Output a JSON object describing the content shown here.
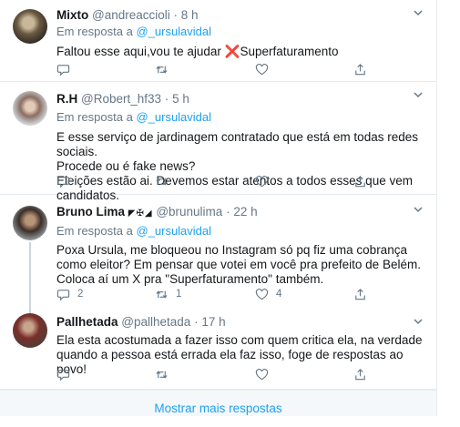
{
  "tweets": [
    {
      "name": "Mixto",
      "handle": "@andreaccioli",
      "time": "8 h",
      "reply_prefix": "Em resposta a",
      "reply_to": "@_ursulavidal",
      "text_before": "Faltou esse aqui,vou te ajudar ",
      "mark": "❌",
      "text_after": "Superfaturamento",
      "replies": "",
      "retweets": "",
      "likes": ""
    },
    {
      "name": "R.H",
      "handle": "@Robert_hf33",
      "time": "5 h",
      "reply_prefix": "Em resposta a",
      "reply_to": "@_ursulavidal",
      "text": "E esse serviço de jardinagem contratado que está em todas redes sociais.\nProcede ou é fake news?\n Eleições estão ai. Devemos estar atentos a todos esses que vem candidatos.",
      "replies": "",
      "retweets": "",
      "likes": ""
    },
    {
      "name": "Bruno Lima",
      "badges": "◤✠◢",
      "handle": "@brunulima",
      "time": "22 h",
      "reply_prefix": "Em resposta a",
      "reply_to": "@_ursulavidal",
      "text": "Poxa Ursula, me bloqueou no Instagram só pq fiz uma cobrança como eleitor? Em pensar que votei em você pra prefeito de Belém. Coloca aí um X pra \"Superfaturamento\" também.",
      "replies": "2",
      "retweets": "1",
      "likes": "4"
    },
    {
      "name": "Pallhetada",
      "handle": "@pallhetada",
      "time": "17 h",
      "text": "Ela esta acostumada a fazer isso com quem critica ela, na verdade quando a pessoa está errada ela faz isso, foge de respostas ao povo!",
      "replies": "",
      "retweets": "",
      "likes": ""
    }
  ],
  "show_more_label": "Mostrar mais respostas",
  "icons": [
    "chevron-down-icon",
    "reply-icon",
    "retweet-icon",
    "like-icon",
    "share-icon"
  ],
  "colors": {
    "link": "#1da1f2",
    "muted": "#657786",
    "text": "#14171a",
    "mark": "#e0245e"
  }
}
